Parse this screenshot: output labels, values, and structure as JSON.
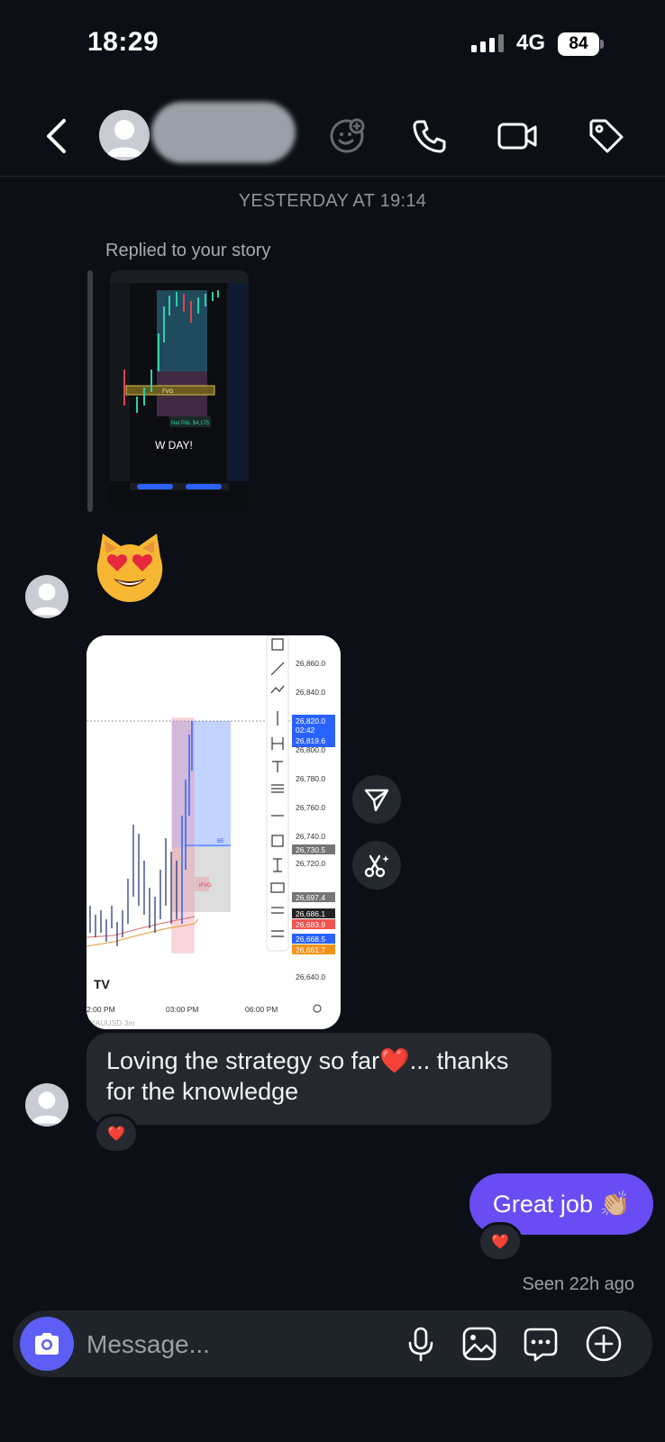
{
  "status_bar": {
    "time": "18:29",
    "network": "4G",
    "battery": "84"
  },
  "header": {
    "back_icon": "chevron-left-icon",
    "contact_name": "",
    "icons": [
      "effects-icon",
      "phone-icon",
      "video-camera-icon",
      "tag-icon"
    ]
  },
  "thread": {
    "date_separator": "YESTERDAY AT 19:14",
    "story_reply_label": "Replied to your story",
    "story_thumbnail": {
      "labels": [
        "FVG",
        "Net P&L $4,175",
        "W DAY!"
      ]
    },
    "emoji_message": "😻",
    "chart_image": {
      "price_labels": [
        "26,860.0",
        "26,840.0",
        "26,820.0",
        "02:42",
        "26,819.6",
        "26,800.0",
        "26,780.0",
        "26,760.0",
        "26,740.0",
        "26,730.5",
        "26,720.0",
        "26,697.4",
        "26,686.1",
        "26,683.9",
        "26,668.5",
        "26,661.7",
        "26,640.0"
      ],
      "time_labels": [
        "2:00 PM",
        "03:00 PM",
        "06:00 PM"
      ],
      "annotations": [
        "BE",
        "iFVG"
      ],
      "watermark": "XAUUSD 3m"
    },
    "incoming_text": "Loving the strategy so far❤️... thanks for the knowledge",
    "incoming_reaction": "❤️",
    "outgoing_text": "Great job 👏🏼",
    "outgoing_reaction": "❤️",
    "seen_status": "Seen 22h ago"
  },
  "composer": {
    "placeholder": "Message...",
    "icons": [
      "camera-icon",
      "microphone-icon",
      "gallery-icon",
      "sticker-icon",
      "plus-icon"
    ]
  },
  "colors": {
    "background": "#0c1016",
    "incoming_bubble": "#25292f",
    "outgoing_bubble": "#6a4cf5",
    "camera_button": "#5d5ef5"
  }
}
